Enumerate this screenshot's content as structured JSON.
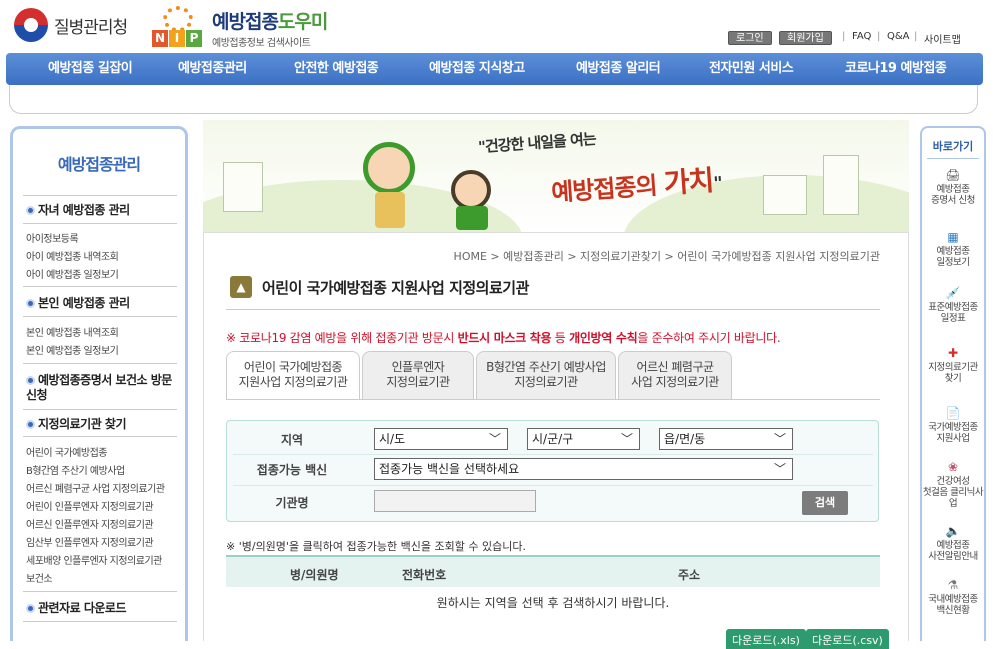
{
  "header": {
    "agency_name": "질병관리청",
    "site_title_main": "예방접종",
    "site_title_accent": "도우미",
    "site_subtitle": "예방접종정보 검색사이트",
    "nip_letters": [
      "N",
      "I",
      "P"
    ],
    "login_label": "로그인",
    "join_label": "회원가입",
    "faq_label": "FAQ",
    "qna_label": "Q&A",
    "sitemap_label": "사이트맵",
    "separator": "|"
  },
  "gnb": [
    "예방접종 길잡이",
    "예방접종관리",
    "안전한 예방접종",
    "예방접종 지식창고",
    "예방접종 알리터",
    "전자민원 서비스",
    "코로나19 예방접종"
  ],
  "lnb": {
    "title": "예방접종관리",
    "sections": [
      {
        "label": "자녀 예방접종 관리",
        "links": [
          "아이정보등록",
          "아이 예방접종 내역조회",
          "아이 예방접종 일정보기"
        ]
      },
      {
        "label": "본인 예방접종 관리",
        "links": [
          "본인 예방접종 내역조회",
          "본인 예방접종 일정보기"
        ]
      },
      {
        "label": "예방접종증명서 보건소 방문신청",
        "links": []
      },
      {
        "label": "지정의료기관 찾기",
        "links": [
          "어린이 국가예방접종",
          "B형간염 주산기 예방사업",
          "어르신 폐렴구균 사업 지정의료기관",
          "어린이 인플루엔자 지정의료기관",
          "어르신 인플루엔자 지정의료기관",
          "임산부 인플루엔자 지정의료기관",
          "세포배양 인플루엔자 지정의료기관",
          "보건소"
        ]
      },
      {
        "label": "관련자료 다운로드",
        "links": []
      }
    ]
  },
  "banner": {
    "line1": "\"건강한 내일을 여는",
    "line2_main": "예방접종의",
    "line2_accent": "가치",
    "line2_end": "\""
  },
  "content": {
    "breadcrumb": "HOME  >  예방접종관리  >  지정의료기관찾기  >  어린이 국가예방접종 지원사업 지정의료기관",
    "page_title": "어린이 국가예방접종 지원사업 지정의료기관",
    "notice_pre": "※ 코로나19 감염 예방을 위해 접종기관 방문시 ",
    "notice_b1": "반드시 마스크 착용",
    "notice_mid": " 등 ",
    "notice_b2": "개인방역 수칙",
    "notice_post": "을 준수하여 주시기 바랍니다.",
    "tabs": [
      {
        "line1": "어린이 국가예방접종",
        "line2": "지원사업 지정의료기관",
        "active": true
      },
      {
        "line1": "인플루엔자",
        "line2": "지정의료기관",
        "active": false
      },
      {
        "line1": "B형간염 주산기 예방사업",
        "line2": "지정의료기관",
        "active": false
      },
      {
        "line1": "어르신 폐렴구균",
        "line2": "사업 지정의료기관",
        "active": false
      }
    ],
    "form": {
      "region_label": "지역",
      "sido": "시/도",
      "sigungu": "시/군/구",
      "eupmyeon": "읍/면/동",
      "vaccine_label": "접종가능 백신",
      "vaccine_value": "접종가능 백신을 선택하세요",
      "org_label": "기관명",
      "org_value": "",
      "search_label": "검색"
    },
    "hint": "※ '병/의원명'을 클릭하여 접종가능한 백신을 조회할 수 있습니다.",
    "table": {
      "columns": [
        "병/의원명",
        "전화번호",
        "주소"
      ],
      "empty_message": "원하시는 지역을 선택 후 검색하시기 바랍니다."
    },
    "download_xls": "다운로드(.xls)",
    "download_csv": "다운로드(.csv)"
  },
  "quick": {
    "title": "바로가기",
    "items": [
      {
        "l1": "예방접종",
        "l2": "증명서 신청",
        "icon": "printer-icon",
        "glyph": "🖨"
      },
      {
        "l1": "예방접종",
        "l2": "일정보기",
        "icon": "calendar-icon",
        "glyph": "▦"
      },
      {
        "l1": "표준예방접종",
        "l2": "일정표",
        "icon": "syringe-icon",
        "glyph": "💉"
      },
      {
        "l1": "지정의료기관",
        "l2": "찾기",
        "icon": "hospital-icon",
        "glyph": "✚"
      },
      {
        "l1": "국가예방접종",
        "l2": "지원사업",
        "icon": "document-icon",
        "glyph": "📄"
      },
      {
        "l1": "건강여성",
        "l2": "첫걸음 클리닉사업",
        "icon": "clinic-icon",
        "glyph": "❀"
      },
      {
        "l1": "예방접종",
        "l2": "사전알림안내",
        "icon": "speaker-icon",
        "glyph": "🔈"
      },
      {
        "l1": "국내예방접종",
        "l2": "백신현황",
        "icon": "vial-icon",
        "glyph": "⚗"
      }
    ]
  },
  "colors": {
    "gnb": "#3c70c4",
    "notice": "#d0102a",
    "accent_green": "#2e9b6e"
  }
}
